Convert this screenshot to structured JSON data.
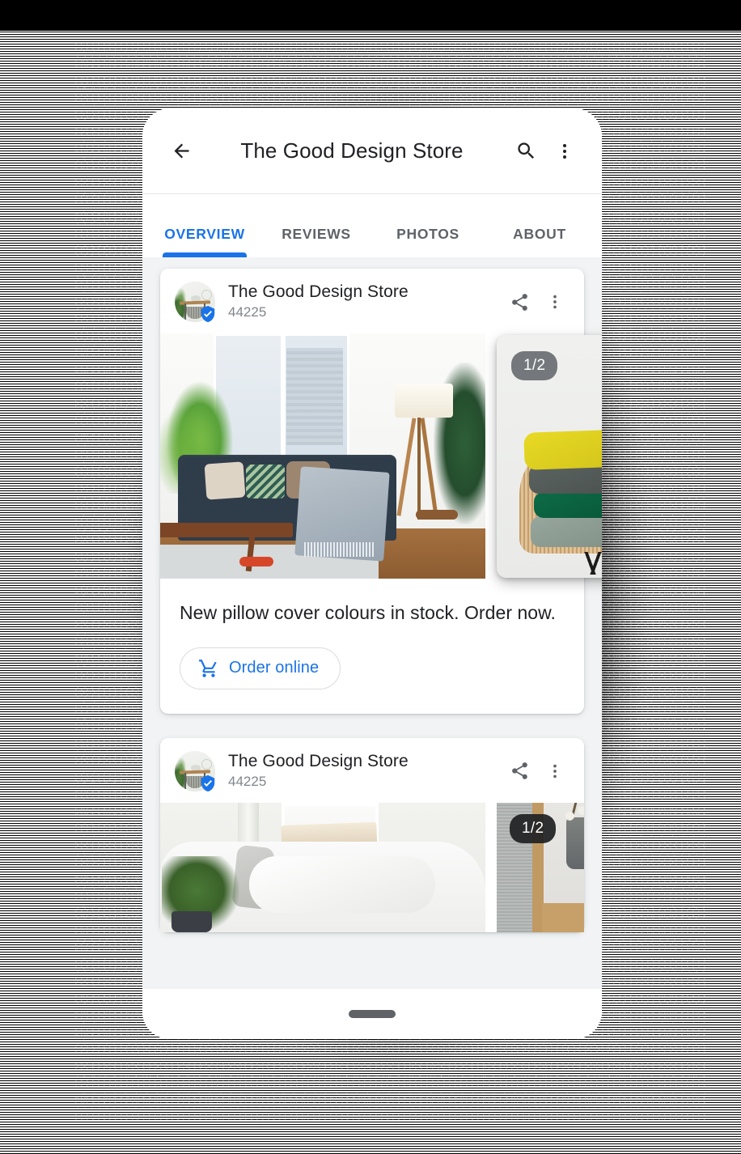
{
  "app": {
    "title": "The Good Design Store",
    "back_icon": "back-arrow-icon",
    "search_icon": "search-icon",
    "overflow_icon": "more-vert-icon"
  },
  "tabs": [
    {
      "label": "OVERVIEW",
      "active": true
    },
    {
      "label": "REVIEWS",
      "active": false
    },
    {
      "label": "PHOTOS",
      "active": false
    },
    {
      "label": "ABOUT",
      "active": false
    }
  ],
  "posts": [
    {
      "store_name": "The Good Design Store",
      "store_id": "44225",
      "verified": true,
      "share_icon": "share-icon",
      "menu_icon": "more-vert-icon",
      "media_count": "1/2",
      "body_text": "New pillow cover colours in stock. Order now.",
      "cta": {
        "label": "Order online",
        "icon": "shopping-cart-icon",
        "color": "#1a73e8"
      }
    },
    {
      "store_name": "The Good Design Store",
      "store_id": "44225",
      "verified": true,
      "share_icon": "share-icon",
      "menu_icon": "more-vert-icon",
      "media_count": "1/2"
    }
  ],
  "system": {
    "home_indicator": "home-indicator"
  },
  "colors": {
    "accent": "#1a73e8",
    "text_primary": "#202124",
    "text_secondary": "#5f6368",
    "text_muted": "#80868b",
    "surface": "#ffffff",
    "background": "#f1f3f4",
    "badge_light": "#5f6368",
    "badge_dark": "#202124"
  }
}
